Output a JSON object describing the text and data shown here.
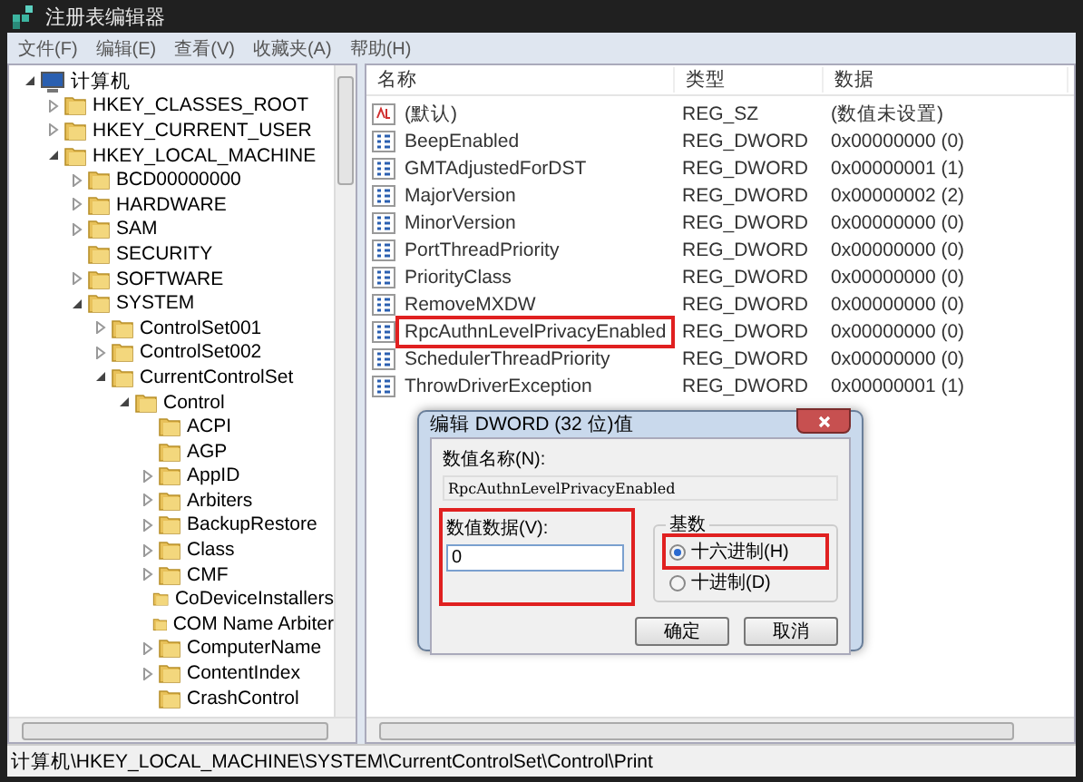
{
  "window": {
    "title": "注册表编辑器"
  },
  "menu": [
    "文件(F)",
    "编辑(E)",
    "查看(V)",
    "收藏夹(A)",
    "帮助(H)"
  ],
  "tree": [
    {
      "label": "计算机",
      "kind": "computer",
      "expanded": true,
      "children": [
        {
          "label": "HKEY_CLASSES_ROOT",
          "kind": "branch",
          "expanded": false
        },
        {
          "label": "HKEY_CURRENT_USER",
          "kind": "branch",
          "expanded": false
        },
        {
          "label": "HKEY_LOCAL_MACHINE",
          "kind": "branch",
          "expanded": true,
          "children": [
            {
              "label": "BCD00000000",
              "kind": "branch",
              "expanded": false
            },
            {
              "label": "HARDWARE",
              "kind": "branch",
              "expanded": false
            },
            {
              "label": "SAM",
              "kind": "branch",
              "expanded": false
            },
            {
              "label": "SECURITY",
              "kind": "leaf"
            },
            {
              "label": "SOFTWARE",
              "kind": "branch",
              "expanded": false
            },
            {
              "label": "SYSTEM",
              "kind": "branch",
              "expanded": true,
              "children": [
                {
                  "label": "ControlSet001",
                  "kind": "branch",
                  "expanded": false
                },
                {
                  "label": "ControlSet002",
                  "kind": "branch",
                  "expanded": false
                },
                {
                  "label": "CurrentControlSet",
                  "kind": "branch",
                  "expanded": true,
                  "children": [
                    {
                      "label": "Control",
                      "kind": "branch",
                      "expanded": true,
                      "children": [
                        {
                          "label": "ACPI",
                          "kind": "leaf"
                        },
                        {
                          "label": "AGP",
                          "kind": "leaf"
                        },
                        {
                          "label": "AppID",
                          "kind": "branch",
                          "expanded": false
                        },
                        {
                          "label": "Arbiters",
                          "kind": "branch",
                          "expanded": false
                        },
                        {
                          "label": "BackupRestore",
                          "kind": "branch",
                          "expanded": false
                        },
                        {
                          "label": "Class",
                          "kind": "branch",
                          "expanded": false
                        },
                        {
                          "label": "CMF",
                          "kind": "branch",
                          "expanded": false
                        },
                        {
                          "label": "CoDeviceInstallers",
                          "kind": "leaf"
                        },
                        {
                          "label": "COM Name Arbiter",
                          "kind": "leaf"
                        },
                        {
                          "label": "ComputerName",
                          "kind": "branch",
                          "expanded": false
                        },
                        {
                          "label": "ContentIndex",
                          "kind": "branch",
                          "expanded": false
                        },
                        {
                          "label": "CrashControl",
                          "kind": "leaf"
                        }
                      ]
                    }
                  ]
                }
              ]
            }
          ]
        }
      ]
    }
  ],
  "list": {
    "columns": [
      "名称",
      "类型",
      "数据"
    ],
    "rows": [
      {
        "name": "(默认)",
        "kind": "string",
        "type": "REG_SZ",
        "data": "(数值未设置)",
        "highlighted": false
      },
      {
        "name": "BeepEnabled",
        "kind": "binary",
        "type": "REG_DWORD",
        "data": "0x00000000 (0)",
        "highlighted": false
      },
      {
        "name": "GMTAdjustedForDST",
        "kind": "binary",
        "type": "REG_DWORD",
        "data": "0x00000001 (1)",
        "highlighted": false
      },
      {
        "name": "MajorVersion",
        "kind": "binary",
        "type": "REG_DWORD",
        "data": "0x00000002 (2)",
        "highlighted": false
      },
      {
        "name": "MinorVersion",
        "kind": "binary",
        "type": "REG_DWORD",
        "data": "0x00000000 (0)",
        "highlighted": false
      },
      {
        "name": "PortThreadPriority",
        "kind": "binary",
        "type": "REG_DWORD",
        "data": "0x00000000 (0)",
        "highlighted": false
      },
      {
        "name": "PriorityClass",
        "kind": "binary",
        "type": "REG_DWORD",
        "data": "0x00000000 (0)",
        "highlighted": false
      },
      {
        "name": "RemoveMXDW",
        "kind": "binary",
        "type": "REG_DWORD",
        "data": "0x00000000 (0)",
        "highlighted": false
      },
      {
        "name": "RpcAuthnLevelPrivacyEnabled",
        "kind": "binary",
        "type": "REG_DWORD",
        "data": "0x00000000 (0)",
        "highlighted": true
      },
      {
        "name": "SchedulerThreadPriority",
        "kind": "binary",
        "type": "REG_DWORD",
        "data": "0x00000000 (0)",
        "highlighted": false
      },
      {
        "name": "ThrowDriverException",
        "kind": "binary",
        "type": "REG_DWORD",
        "data": "0x00000001 (1)",
        "highlighted": false
      }
    ]
  },
  "dialog": {
    "title": "编辑 DWORD (32 位)值",
    "name_label": "数值名称(N):",
    "name_value": "RpcAuthnLevelPrivacyEnabled",
    "data_label": "数值数据(V):",
    "data_value": "0",
    "data_highlighted": true,
    "base_label": "基数",
    "bases": [
      {
        "label": "十六进制(H)",
        "selected": true,
        "highlighted": true
      },
      {
        "label": "十进制(D)",
        "selected": false,
        "highlighted": false
      }
    ],
    "buttons": [
      "确定",
      "取消"
    ]
  },
  "status_bar": "计算机\\HKEY_LOCAL_MACHINE\\SYSTEM\\CurrentControlSet\\Control\\Print"
}
